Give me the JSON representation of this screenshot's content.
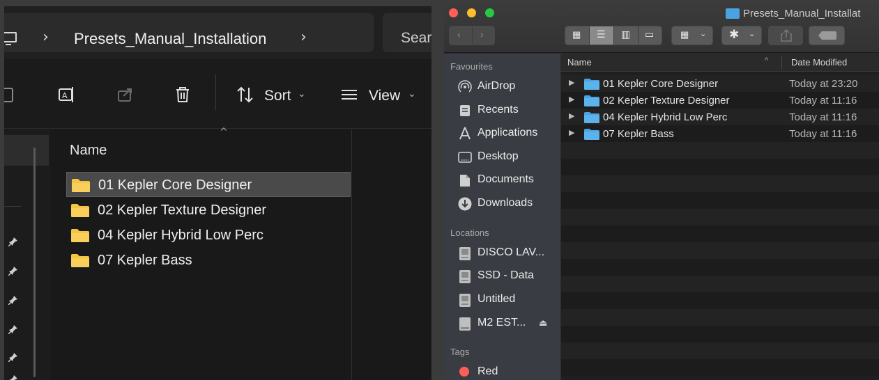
{
  "windows_explorer": {
    "breadcrumb": "Presets_Manual_Installation",
    "search_placeholder": "Sear",
    "toolbar": {
      "sort_label": "Sort",
      "view_label": "View"
    },
    "column_name": "Name",
    "items": [
      {
        "name": "01 Kepler Core Designer",
        "selected": true
      },
      {
        "name": "02 Kepler Texture Designer",
        "selected": false
      },
      {
        "name": "04 Kepler Hybrid Low Perc",
        "selected": false
      },
      {
        "name": "07 Kepler Bass",
        "selected": false
      }
    ],
    "icons": {
      "folder_color": "#f4c542"
    }
  },
  "mac_finder": {
    "window_title": "Presets_Manual_Installat",
    "sidebar": {
      "favourites_heading": "Favourites",
      "favourites": [
        {
          "label": "AirDrop",
          "icon": "airdrop-icon"
        },
        {
          "label": "Recents",
          "icon": "recents-icon"
        },
        {
          "label": "Applications",
          "icon": "applications-icon"
        },
        {
          "label": "Desktop",
          "icon": "desktop-icon"
        },
        {
          "label": "Documents",
          "icon": "documents-icon"
        },
        {
          "label": "Downloads",
          "icon": "downloads-icon"
        }
      ],
      "locations_heading": "Locations",
      "locations": [
        {
          "label": "DISCO LAV...",
          "icon": "disk-icon"
        },
        {
          "label": "SSD - Data",
          "icon": "disk-icon"
        },
        {
          "label": "Untitled",
          "icon": "disk-icon"
        },
        {
          "label": "M2 EST...",
          "icon": "drive-icon",
          "eject": "⏏"
        }
      ],
      "tags_heading": "Tags",
      "tags": [
        {
          "label": "Red",
          "color": "#ff5f57"
        }
      ]
    },
    "columns": {
      "name": "Name",
      "date_modified": "Date Modified"
    },
    "rows": [
      {
        "name": "01 Kepler Core Designer",
        "date": "Today at 23:20"
      },
      {
        "name": "02 Kepler Texture Designer",
        "date": "Today at 11:16"
      },
      {
        "name": "04 Kepler Hybrid Low Perc",
        "date": "Today at 11:16"
      },
      {
        "name": "07 Kepler Bass",
        "date": "Today at 11:16"
      }
    ],
    "colors": {
      "folder": "#4aa3e0",
      "close": "#ff5f57",
      "minimize": "#febc2e",
      "zoom": "#28c840"
    }
  }
}
